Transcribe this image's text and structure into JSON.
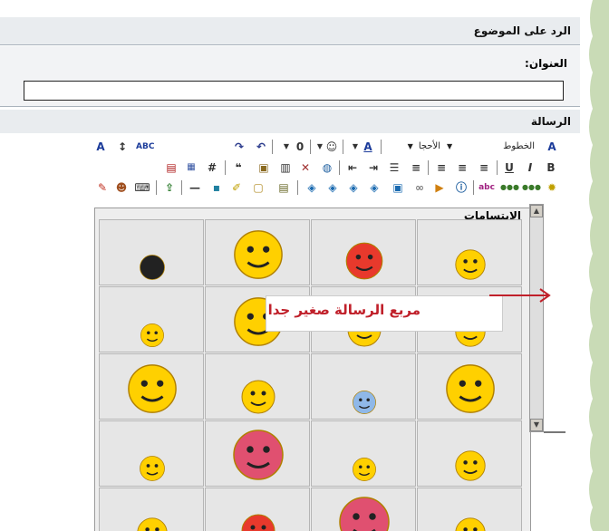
{
  "header": {
    "title": "الرد على الموضوع"
  },
  "subject": {
    "label": "العنوان:",
    "value": ""
  },
  "message": {
    "label": "الرسالة"
  },
  "toolbar": {
    "font_dropdown": "الخطوط",
    "size_dropdown": "الأحجا",
    "bold": "B",
    "italic": "I",
    "underline": "U",
    "hash": "#"
  },
  "smilies": {
    "title": "الابتسامات",
    "items": [
      "smiley-sleepy-small",
      "smiley-angry-red",
      "smiley-surprised-yellow",
      "smiley-ninja-black",
      "smiley-tongue",
      "smiley-grin",
      "smiley-laugh",
      "smiley-love",
      "smiley-cool-sunglasses",
      "smiley-sweat-blue",
      "smiley-dizzy",
      "smiley-sleep-zzz",
      "smiley-shout",
      "smiley-cry",
      "smiley-devil-pink",
      "smiley-shy",
      "smiley-nervous",
      "smiley-shocked-pink",
      "smiley-devil-red",
      "smiley-wink"
    ]
  },
  "annotation": {
    "text": "مربع الرسالة صغير جدا"
  },
  "colors": {
    "bar_bg": "#e9ecef",
    "edge_green": "#c9dbb6",
    "annotation_red": "#c0202a",
    "smiley_yellow": "#ffd000"
  }
}
